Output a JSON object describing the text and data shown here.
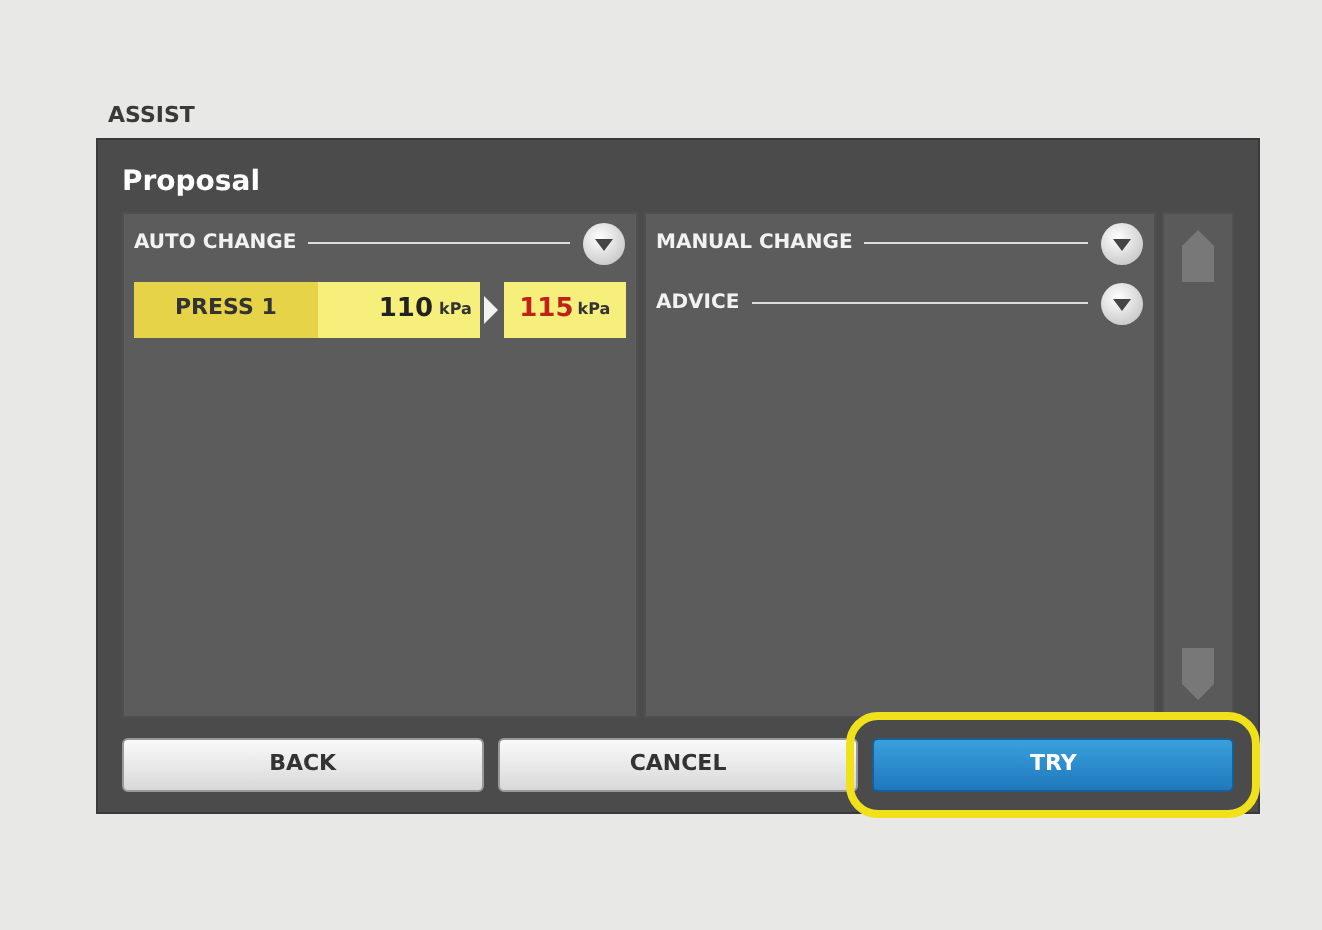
{
  "screen_label": "ASSIST",
  "panel": {
    "title": "Proposal"
  },
  "left_sections": [
    {
      "label": "AUTO CHANGE"
    }
  ],
  "changes": [
    {
      "item": "PRESS 1",
      "current_value": "110",
      "current_unit": "kPa",
      "new_value": "115",
      "new_unit": "kPa"
    }
  ],
  "right_sections": [
    {
      "label": "MANUAL CHANGE"
    },
    {
      "label": "ADVICE"
    }
  ],
  "buttons": [
    {
      "label": "BACK",
      "kind": "default",
      "highlighted": false
    },
    {
      "label": "CANCEL",
      "kind": "default",
      "highlighted": false
    },
    {
      "label": "TRY",
      "kind": "primary",
      "highlighted": true
    }
  ]
}
